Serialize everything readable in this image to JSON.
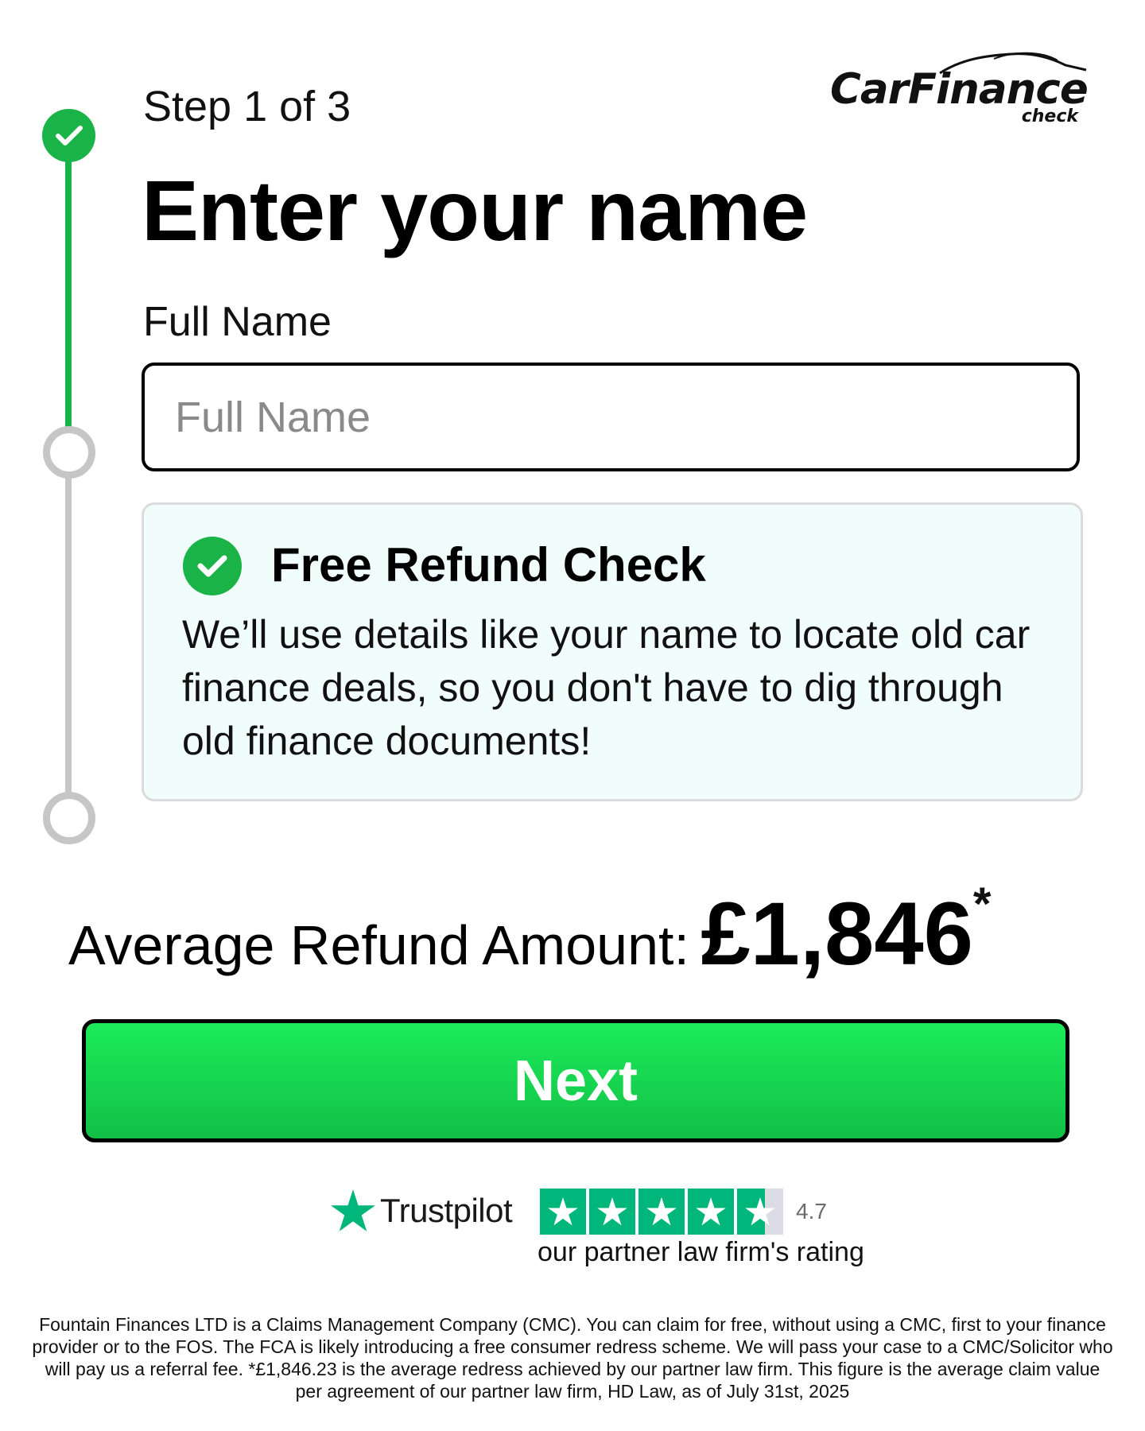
{
  "logo": {
    "brand_part1": "Car",
    "brand_part2": "Finance",
    "sub": "check"
  },
  "stepper": {
    "step_count": "Step 1 of 3",
    "steps": [
      {
        "state": "completed"
      },
      {
        "state": "pending"
      },
      {
        "state": "pending"
      }
    ],
    "colors": {
      "done": "#19b347",
      "pending": "#c6c6c6"
    }
  },
  "form": {
    "title": "Enter your name",
    "field_label": "Full Name",
    "field_placeholder": "Full Name",
    "field_value": ""
  },
  "info_box": {
    "icon": "check-circle-icon",
    "title": "Free Refund Check",
    "body": "We’ll use details like your name to locate old car finance deals, so you don't have to dig through old finance documents!"
  },
  "refund": {
    "label": "Average Refund Amount:",
    "amount": "£1,846",
    "asterisk": "*"
  },
  "next_button": {
    "label": "Next",
    "color": "#19d14f"
  },
  "trustpilot": {
    "brand": "Trustpilot",
    "icon": "trustpilot-star-icon",
    "rating": "4.7",
    "caption": "our partner law firm's rating",
    "star_color": "#00b67a"
  },
  "disclaimer": "Fountain Finances LTD is a Claims Management Company (CMC). You can claim for free, without using a CMC, first to your finance provider or to the FOS. The FCA is likely introducing a free consumer redress scheme. We will pass your case to a CMC/Solicitor who will pay us a referral fee. *£1,846.23 is the average redress achieved by our partner law firm. This figure is the average claim value per agreement of our partner law firm, HD Law, as of July 31st, 2025"
}
